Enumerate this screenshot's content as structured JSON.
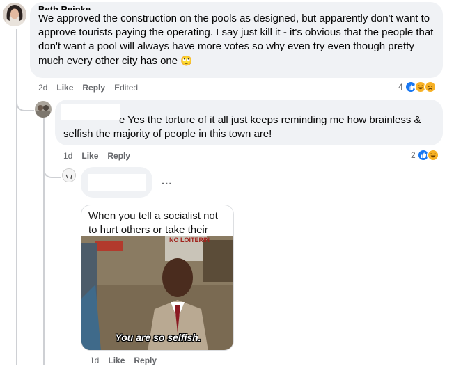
{
  "comments": [
    {
      "author": "Beth Reinke",
      "text": "We approved the construction on the pools as designed, but apparently don't want to approve tourists paying the operating. I say just kill it - it's obvious that the people that don't want a pool will always have more votes so why even try even though pretty much every other city has one",
      "emoji": "🙄",
      "time": "2d",
      "like_label": "Like",
      "reply_label": "Reply",
      "edited_label": "Edited",
      "reaction_count": "4",
      "reactions": [
        "like-icon",
        "haha-icon",
        "sad-icon"
      ]
    },
    {
      "text_fragment": "e Yes the torture of it all just keeps reminding me how brainless &",
      "text_line2": "selfish the majority of people in this town are!",
      "time": "1d",
      "like_label": "Like",
      "reply_label": "Reply",
      "reaction_count": "2",
      "reactions": [
        "like-icon",
        "haha-icon"
      ]
    },
    {
      "more_label": "...",
      "meme_caption": "When you tell a socialist not to hurt others or take their things.",
      "meme_subtitle": "You are so selfish.",
      "sign_text": "NO LOITERIN",
      "time": "1d",
      "like_label": "Like",
      "reply_label": "Reply"
    }
  ],
  "colors": {
    "bubble": "#f0f2f5",
    "meta": "#65676b",
    "like": "#1877f2",
    "haha": "#f7b125"
  }
}
